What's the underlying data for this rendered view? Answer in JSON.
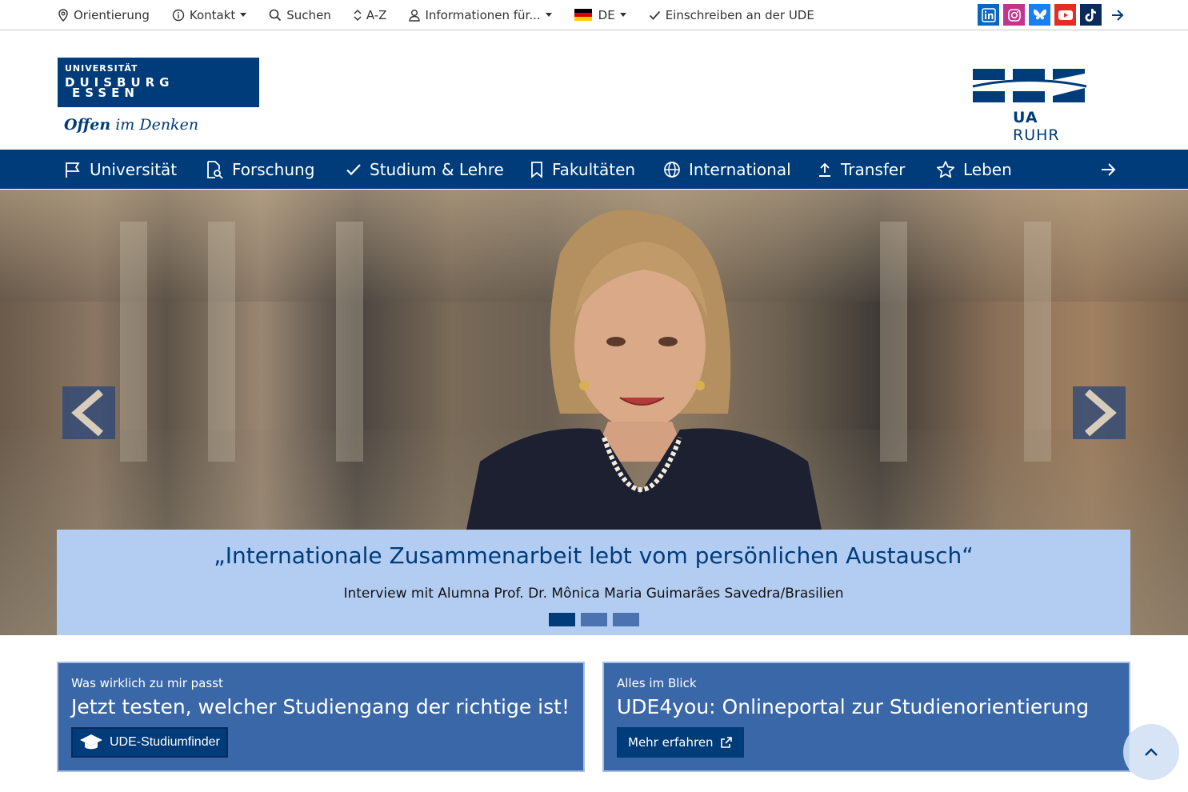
{
  "topbar": {
    "orientierung": "Orientierung",
    "kontakt": "Kontakt",
    "suchen": "Suchen",
    "az": "A-Z",
    "informationen": "Informationen für...",
    "language": "DE",
    "einschreiben": "Einschreiben an der UDE"
  },
  "socials": {
    "linkedin_color": "#0a66c2",
    "instagram_color": "#c1358f",
    "bluesky_color": "#1a7ff0",
    "youtube_color": "#e52d27",
    "tiktok_color": "#0b2a5c"
  },
  "header": {
    "logo_line1": "UNIVERSITÄT",
    "logo_line2": "DUISBURG",
    "logo_line3": "ESSEN",
    "slogan_bold": "Offen",
    "slogan_rest": " im Denken",
    "ua_ruhr_bold": "UA",
    "ua_ruhr_rest": " RUHR"
  },
  "nav": {
    "universitaet": "Universität",
    "forschung": "Forschung",
    "studium": "Studium & Lehre",
    "fakultaeten": "Fakultäten",
    "international": "International",
    "transfer": "Transfer",
    "leben": "Leben"
  },
  "hero": {
    "quote": "„Internationale Zusammenarbeit lebt vom persönlichen Austausch“",
    "subtitle": "Interview mit Alumna Prof. Dr. Mônica Maria Guimarães Savedra/Brasilien",
    "slide_count": 3,
    "active_slide": 1
  },
  "cards": [
    {
      "eyebrow": "Was wirklich zu mir passt",
      "headline": "Jetzt testen, welcher Studiengang der richtige ist!",
      "button": "UDE-Studiumfinder"
    },
    {
      "eyebrow": "Alles im Blick",
      "headline": "UDE4you: Onlineportal zur Studienorientierung",
      "button": "Mehr erfahren"
    }
  ],
  "colors": {
    "brand_blue": "#003b7a",
    "card_blue": "#3a67a8",
    "caption_bg": "#b3cdf2"
  }
}
